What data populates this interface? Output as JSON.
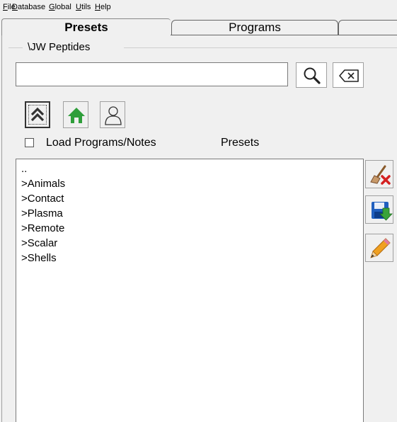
{
  "menu": {
    "items": [
      {
        "acc": "F",
        "rest": "ile"
      },
      {
        "acc": "D",
        "rest": "atabase"
      },
      {
        "acc": "G",
        "rest": "lobal"
      },
      {
        "acc": "U",
        "rest": "tils"
      },
      {
        "acc": "H",
        "rest": "elp"
      }
    ]
  },
  "tabs": {
    "presets": "Presets",
    "programs": "Programs"
  },
  "group": {
    "title": "\\JW Peptides"
  },
  "search": {
    "value": "",
    "placeholder": ""
  },
  "icons": {
    "search": "magnifier-icon",
    "clear": "backspace-clear-icon",
    "up": "double-chevron-up-icon",
    "home": "home-icon",
    "user": "user-icon",
    "delete": "brush-delete-icon",
    "save": "save-disk-icon",
    "edit": "pencil-icon"
  },
  "options": {
    "load_label": "Load Programs/Notes",
    "load_checked": false,
    "list_caption": "Presets"
  },
  "list": {
    "items": [
      "..",
      ">Animals",
      ">Contact",
      ">Plasma",
      ">Remote",
      ">Scalar",
      ">Shells"
    ]
  },
  "colors": {
    "home_green": "#2e9e3a",
    "save_blue": "#1f5fbf",
    "save_green": "#3aa33a",
    "delete_red": "#d42020",
    "pencil_orange": "#f0a020"
  }
}
